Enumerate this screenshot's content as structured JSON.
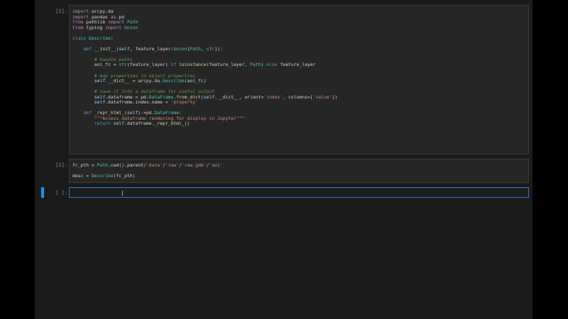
{
  "cells": [
    {
      "prompt": "[1]:",
      "lines": [
        "import arcpy.da",
        "import pandas as pd",
        "from pathlib import Path",
        "from typing import Union",
        "",
        "class Describe:",
        "",
        "    def __init__(self, feature_layer:Union[Path, str]):",
        "",
        "        # handle paths",
        "        aoi_fc = str(feature_layer) if isinstance(feature_layer, Path) else feature_layer",
        "",
        "        # map properties to object properties",
        "        self.__dict__ = arcpy.da.Describe(aoi_fc)",
        "",
        "        # save it into a dataframe for useful output",
        "        self.dataframe = pd.DataFrame.from_dict(self.__dict__, orient='index', columns=['value'])",
        "        self.dataframe.index.name = 'property'",
        "",
        "    def _repr_html_(self)->pd.DataFrame:",
        "        \"\"\"Access dataframe rendering for display in Jupyter\"\"\"",
        "        return self.dataframe._repr_html_()"
      ]
    },
    {
      "prompt": "[2]:",
      "lines": [
        "fc_pth = Path.cwd().parent/'data'/'raw'/'raw.gdb'/'aoi'",
        "",
        "desc = Describe(fc_pth)"
      ]
    },
    {
      "prompt": "[ ]:",
      "lines": []
    }
  ],
  "colors": {
    "background": "#1b1b1c",
    "cell_background": "#262626",
    "active_border": "#2f7ec9",
    "active_marker": "#1e90ff"
  }
}
